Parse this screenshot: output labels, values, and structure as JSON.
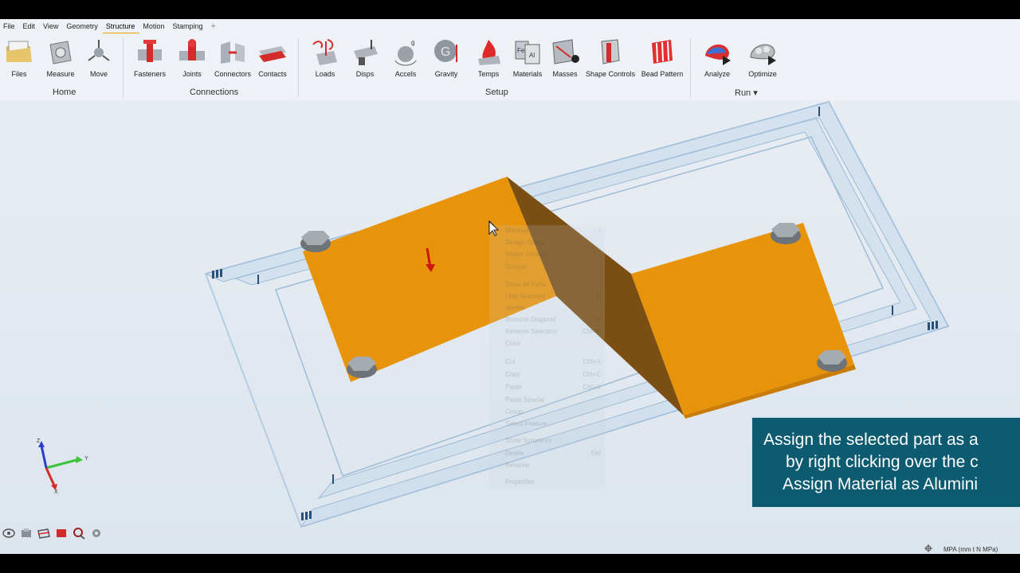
{
  "menu": {
    "items": [
      "File",
      "Edit",
      "View",
      "Geometry",
      "Structure",
      "Motion",
      "Stamping"
    ],
    "active": "Structure",
    "add_tab_symbol": "+"
  },
  "ribbon": {
    "tools": {
      "files": "Files",
      "measure": "Measure",
      "move": "Move",
      "fasteners": "Fasteners",
      "joints": "Joints",
      "connectors": "Connectors",
      "contacts": "Contacts",
      "loads": "Loads",
      "disps": "Disps",
      "accels": "Accels",
      "gravity": "Gravity",
      "temps": "Temps",
      "materials": "Materials",
      "masses": "Masses",
      "shape_controls": "Shape Controls",
      "bead_pattern": "Bead Pattern",
      "analyze": "Analyze",
      "optimize": "Optimize"
    },
    "groups": {
      "home": "Home",
      "connections": "Connections",
      "setup": "Setup",
      "run": "Run ▾"
    }
  },
  "context_menu": {
    "items": [
      {
        "label": "Material",
        "shortcut": "›"
      },
      {
        "label": "Design Space",
        "shortcut": ""
      },
      {
        "label": "Shape Controls",
        "shortcut": "›"
      },
      {
        "label": "Ground",
        "shortcut": ""
      },
      {
        "label": "Show all Parts",
        "shortcut": ""
      },
      {
        "label": "Hide Selected",
        "shortcut": "H"
      },
      {
        "label": "Isolate",
        "shortcut": "I"
      },
      {
        "label": "Remove Diagonal",
        "shortcut": "R"
      },
      {
        "label": "Reverse Selection",
        "shortcut": "Ctrl+R"
      },
      {
        "label": "Color",
        "shortcut": ""
      },
      {
        "label": "Cut",
        "shortcut": "Ctrl+X"
      },
      {
        "label": "Copy",
        "shortcut": "Ctrl+C"
      },
      {
        "label": "Paste",
        "shortcut": "Ctrl+V"
      },
      {
        "label": "Paste Special",
        "shortcut": ""
      },
      {
        "label": "Group",
        "shortcut": ""
      },
      {
        "label": "Select Feature",
        "shortcut": ""
      },
      {
        "label": "Show Symmetry",
        "shortcut": ""
      },
      {
        "label": "Delete",
        "shortcut": "Del"
      },
      {
        "label": "Rename",
        "shortcut": ""
      },
      {
        "label": "Properties",
        "shortcut": ""
      }
    ]
  },
  "caption": {
    "line1": "Assign the selected part as a",
    "line2": "by right clicking over the c",
    "line3": "Assign Material as Alumini"
  },
  "triad": {
    "x": "Y",
    "y": "Z",
    "z": "X"
  },
  "status": {
    "units": "MPA (mm t N MPa)"
  },
  "colors": {
    "part_orange": "#e8940a",
    "frame_blue": "#c4d9ec",
    "caption_bg": "#0d5b71",
    "load_red": "#d11414"
  }
}
